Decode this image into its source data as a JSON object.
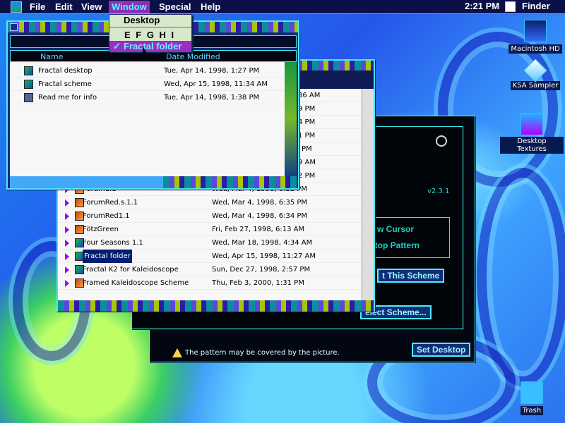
{
  "menu_bar": {
    "items": [
      "File",
      "Edit",
      "View",
      "Window",
      "Special",
      "Help"
    ],
    "clock": "2:21 PM",
    "active_app": "Finder"
  },
  "window_menu": {
    "items": [
      "Desktop",
      "E F G H I",
      "Fractal folder"
    ],
    "checked_item": "Fractal folder"
  },
  "desktop_icons": [
    {
      "label": "Macintosh HD",
      "icon": "hard-drive-icon"
    },
    {
      "label": "KSA Sampler",
      "icon": "app-sampler-icon"
    },
    {
      "label": "Desktop Textures",
      "icon": "textures-folder-icon"
    },
    {
      "label": "Trash",
      "icon": "trash-icon"
    }
  ],
  "small_window": {
    "columns": [
      "Name",
      "Date Modified"
    ],
    "rows": [
      {
        "name": "Fractal desktop",
        "date": "Tue, Apr 14, 1998, 1:27 PM"
      },
      {
        "name": "Fractal scheme",
        "date": "Wed, Apr 15, 1998, 11:34 AM"
      },
      {
        "name": "Read me for info",
        "date": "Tue, Apr 14, 1998, 1:38 PM"
      }
    ]
  },
  "large_window": {
    "partial_times": [
      "36 AM",
      "9 PM",
      "4 PM",
      "1 PM",
      "PM",
      "9 AM",
      "2 PM"
    ],
    "rows": [
      {
        "name": "Forum1.1",
        "date": "Wed, Mar 4, 1998, 6:32 PM"
      },
      {
        "name": "ForumRed.s.1.1",
        "date": "Wed, Mar 4, 1998, 6:35 PM"
      },
      {
        "name": "ForumRed1.1",
        "date": "Wed, Mar 4, 1998, 6:34 PM"
      },
      {
        "name": "FötzGreen",
        "date": "Fri, Feb 27, 1998, 6:13 AM"
      },
      {
        "name": "Four Seasons 1.1",
        "date": "Wed, Mar 18, 1998, 4:34 AM"
      },
      {
        "name": "Fractal folder",
        "date": "Wed, Apr 15, 1998, 11:27 AM"
      },
      {
        "name": "Fractal K2 for Kaleidoscope",
        "date": "Sun, Dec 27, 1998, 2:57 PM"
      },
      {
        "name": "Framed Kaleidoscope Scheme",
        "date": "Thu, Feb 3, 2000, 1:31 PM"
      }
    ]
  },
  "scheme_panel": {
    "version": "v2.3.1",
    "items": [
      "w Cursor",
      "ktop Pattern"
    ],
    "buttons": [
      "t This Scheme",
      "elect Scheme...",
      "Set Desktop"
    ],
    "warning": "The pattern may be covered by the picture."
  }
}
